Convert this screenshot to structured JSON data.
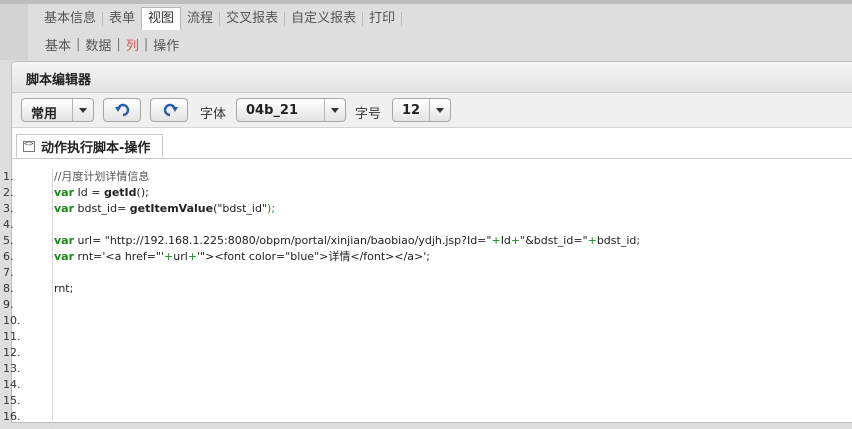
{
  "top_nav": {
    "tabs": [
      "基本信息",
      "表单",
      "视图",
      "流程",
      "交叉报表",
      "自定义报表",
      "打印"
    ],
    "active_index": 2
  },
  "sub_nav": {
    "items": [
      "基本",
      "数据",
      "列",
      "操作"
    ],
    "active_index": 2,
    "separator": "|"
  },
  "panel": {
    "title": "脚本编辑器"
  },
  "toolbar": {
    "mode_value": "常用",
    "font_label": "字体",
    "font_value": "04b_21",
    "size_label": "字号",
    "size_value": "12"
  },
  "script_tab": {
    "label": "动作执行脚本-操作"
  },
  "editor": {
    "line_numbers": [
      "1.",
      "2.",
      "3.",
      "4.",
      "5.",
      "6.",
      "7.",
      "8.",
      "9.",
      "10.",
      "11.",
      "12.",
      "13.",
      "14.",
      "15.",
      "16."
    ],
    "lines": {
      "l1_comment": "//月度计划详情信息",
      "l2_kw": "var",
      "l2_a": " Id = ",
      "l2_fn": "getId",
      "l2_b": "();",
      "l3_kw": "var",
      "l3_a": " bdst_id= ",
      "l3_fn": "getItemValue",
      "l3_b": "(\"bdst_id\"",
      "l3_c": ");",
      "l5_kw": "var",
      "l5_a": " url= \"http://192.168.1.225:8080/obpm/portal/xinjian/baobiao/ydjh.jsp?Id=\"",
      "l5_p1": "+",
      "l5_b": "Id",
      "l5_p2": "+",
      "l5_c": "\"&bdst_id=\"",
      "l5_p3": "+",
      "l5_d": "bdst_id;",
      "l6_kw": "var",
      "l6_a": " rnt='<a href=\"'",
      "l6_p1": "+",
      "l6_b": "url",
      "l6_p2": "+",
      "l6_c": "'\"><font color=\"blue\">详情</font></a>';",
      "l8": "rnt;"
    }
  }
}
